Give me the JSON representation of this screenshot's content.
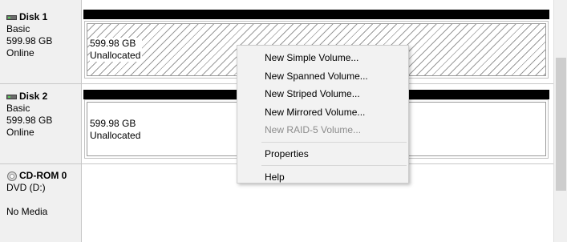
{
  "disks": [
    {
      "name": "Disk 1",
      "type": "Basic",
      "size": "599.98 GB",
      "status": "Online",
      "volume": {
        "size": "599.98 GB",
        "state": "Unallocated"
      }
    },
    {
      "name": "Disk 2",
      "type": "Basic",
      "size": "599.98 GB",
      "status": "Online",
      "volume": {
        "size": "599.98 GB",
        "state": "Unallocated"
      }
    }
  ],
  "cdrom": {
    "name": "CD-ROM 0",
    "type": "DVD (D:)",
    "media": "No Media"
  },
  "context_menu": {
    "items": [
      {
        "label": "New Simple Volume...",
        "enabled": true
      },
      {
        "label": "New Spanned Volume...",
        "enabled": true
      },
      {
        "label": "New Striped Volume...",
        "enabled": true
      },
      {
        "label": "New Mirrored Volume...",
        "enabled": true
      },
      {
        "label": "New RAID-5 Volume...",
        "enabled": false
      },
      {
        "label": "Properties",
        "enabled": true
      },
      {
        "label": "Help",
        "enabled": true
      }
    ]
  },
  "colors": {
    "volume_header": "#000000",
    "menu_bg": "#f2f2f2",
    "disabled_text": "#8c8c8c"
  }
}
